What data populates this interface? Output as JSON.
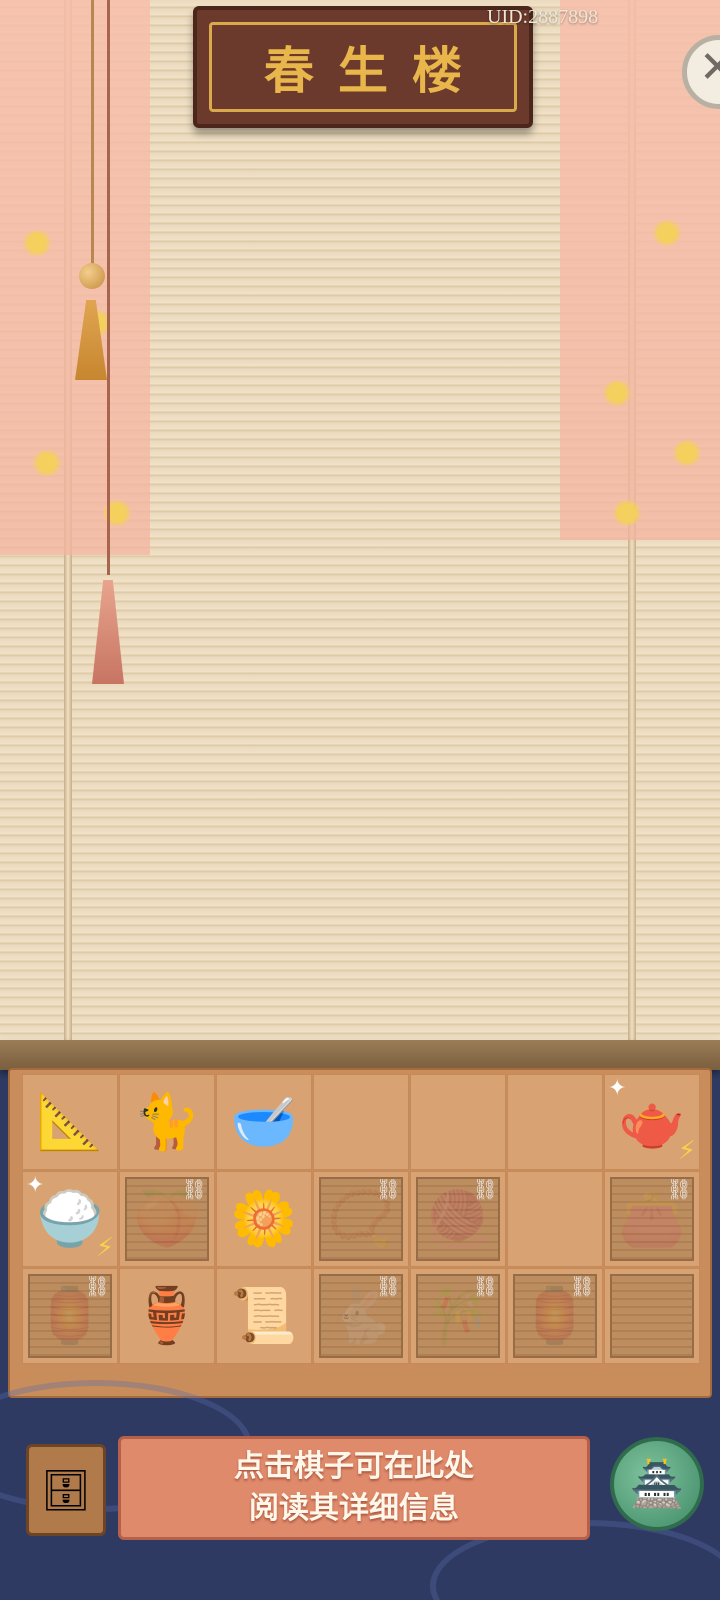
{
  "header": {
    "sign_title": "春生楼",
    "uid_text": "UID:2887898"
  },
  "icons": {
    "close": "close-icon",
    "cabinet": "cabinet-icon",
    "pavilion": "pavilion-icon"
  },
  "close_glyph": "✕",
  "board": {
    "rows": [
      [
        {
          "name": "ruler-brush-item",
          "glyph": "📐"
        },
        {
          "name": "cat-item",
          "glyph": "🐈"
        },
        {
          "name": "porridge-bowl-item",
          "glyph": "🥣"
        },
        {
          "name": "empty-cell",
          "glyph": ""
        },
        {
          "name": "empty-cell",
          "glyph": ""
        },
        {
          "name": "empty-cell",
          "glyph": ""
        },
        {
          "name": "tea-pot-item",
          "glyph": "🫖",
          "sparkle": "✦",
          "energy": "⚡"
        }
      ],
      [
        {
          "name": "rice-bucket-item",
          "glyph": "🍚",
          "sparkle": "✦",
          "energy": "⚡"
        },
        {
          "name": "bunny-bowl-item",
          "glyph": "🍑",
          "chain": "⛓",
          "locked": true
        },
        {
          "name": "cotton-item",
          "glyph": "🌼"
        },
        {
          "name": "jade-bracelet-item",
          "glyph": "📿",
          "chain": "⛓",
          "locked": true
        },
        {
          "name": "bamboo-ball-item",
          "glyph": "🧶",
          "chain": "⛓",
          "locked": true
        },
        {
          "name": "empty-cell",
          "glyph": ""
        },
        {
          "name": "purple-pouch-item",
          "glyph": "👛",
          "chain": "⛓",
          "locked": true
        }
      ],
      [
        {
          "name": "lantern-item",
          "glyph": "🏮",
          "chain": "⛓",
          "locked": true
        },
        {
          "name": "porcelain-bowl-item",
          "glyph": "🏺"
        },
        {
          "name": "scroll-brush-item",
          "glyph": "📜"
        },
        {
          "name": "bunny-bowl-item",
          "glyph": "🐇",
          "chain": "⛓",
          "locked": true
        },
        {
          "name": "bamboo-blind-item",
          "glyph": "🎋",
          "chain": "⛓",
          "locked": true
        },
        {
          "name": "lantern-item",
          "glyph": "🏮",
          "chain": "⛓",
          "locked": true
        },
        {
          "name": "wooden-shutter-item",
          "glyph": "",
          "locked": true
        }
      ]
    ]
  },
  "footer": {
    "info_line1": "点击棋子可在此处",
    "info_line2": "阅读其详细信息",
    "cabinet_glyph": "🗄",
    "pavilion_glyph": "🏯"
  }
}
